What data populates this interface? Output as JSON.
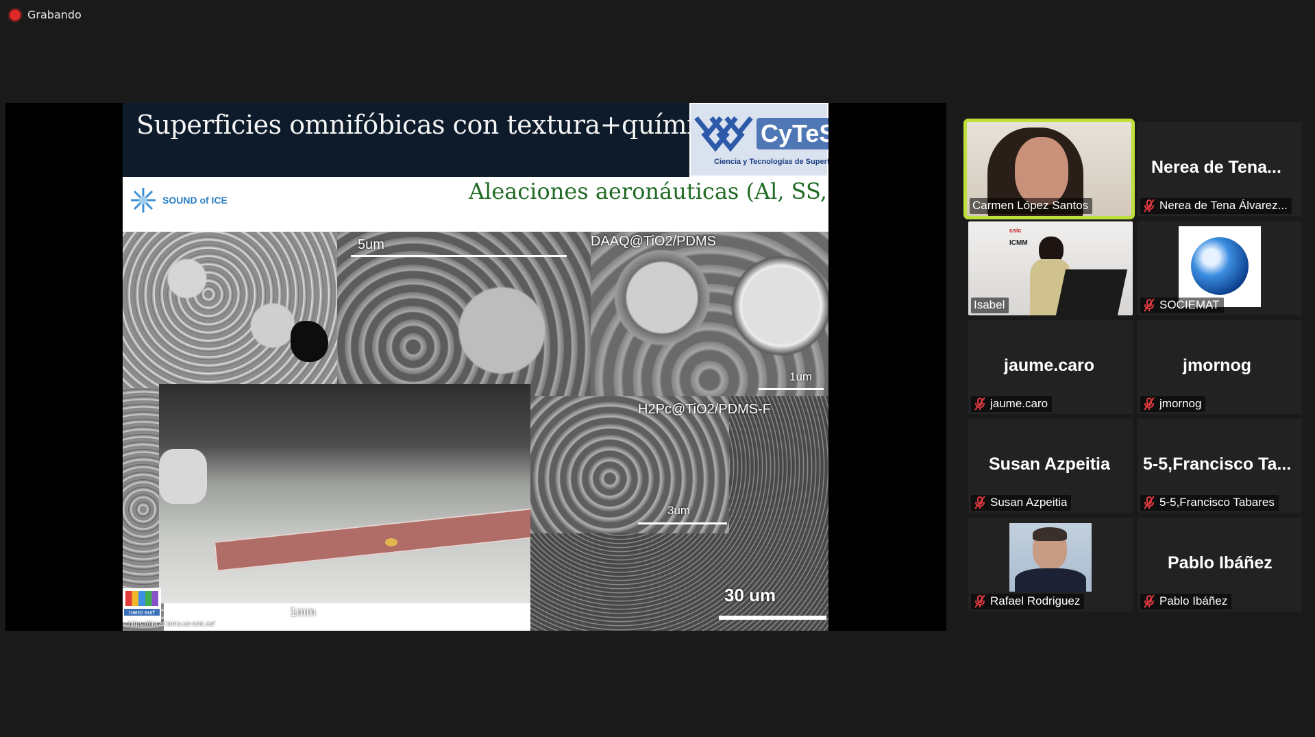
{
  "recording": {
    "label": "Grabando"
  },
  "slide": {
    "title": "Superficies omnifóbicas con textura+química a la carta",
    "logo_text": "CyTeS",
    "logo_subtext": "Ciencia y Tecnologías de Superficies",
    "sound_logo": "SOUND of ICE",
    "subtitle": "Aleaciones aeronáuticas (Al, SS,...)",
    "sem1_scale": "5um",
    "sem2_label": "DAAQ@TiO2/PDMS",
    "sem2_scale": "1um",
    "sem3_label": "H2Pc@TiO2/PDMS-F",
    "sem3_scale": "3um",
    "photo_scale": "1mm",
    "big_scale": "30 um",
    "nano_logo": "nano surf",
    "footer_url": "https://lincaf.icms.us-csic.es/"
  },
  "participants": [
    {
      "name": "Carmen López Santos",
      "tile_title": "",
      "muted": false,
      "active": true,
      "media": "video"
    },
    {
      "name": "Nerea de Tena Álvarez...",
      "tile_title": "Nerea de Tena...",
      "muted": true,
      "active": false,
      "media": "name"
    },
    {
      "name": "Isabel",
      "tile_title": "",
      "muted": false,
      "active": false,
      "media": "video"
    },
    {
      "name": "SOCIEMAT",
      "tile_title": "",
      "muted": true,
      "active": false,
      "media": "logo"
    },
    {
      "name": "jaume.caro",
      "tile_title": "jaume.caro",
      "muted": true,
      "active": false,
      "media": "name"
    },
    {
      "name": "jmornog",
      "tile_title": "jmornog",
      "muted": true,
      "active": false,
      "media": "name"
    },
    {
      "name": "Susan Azpeitia",
      "tile_title": "Susan Azpeitia",
      "muted": true,
      "active": false,
      "media": "name"
    },
    {
      "name": "5-5,Francisco Tabares",
      "tile_title": "5-5,Francisco  Ta...",
      "muted": true,
      "active": false,
      "media": "name"
    },
    {
      "name": "Rafael Rodriguez",
      "tile_title": "",
      "muted": true,
      "active": false,
      "media": "photo"
    },
    {
      "name": "Pablo Ibáñez",
      "tile_title": "Pablo Ibáñez",
      "muted": true,
      "active": false,
      "media": "name"
    }
  ],
  "colors": {
    "background": "#1a1a1a",
    "active_speaker": "#bfe03a",
    "muted_icon": "#e0393e",
    "tile": "#222222"
  }
}
